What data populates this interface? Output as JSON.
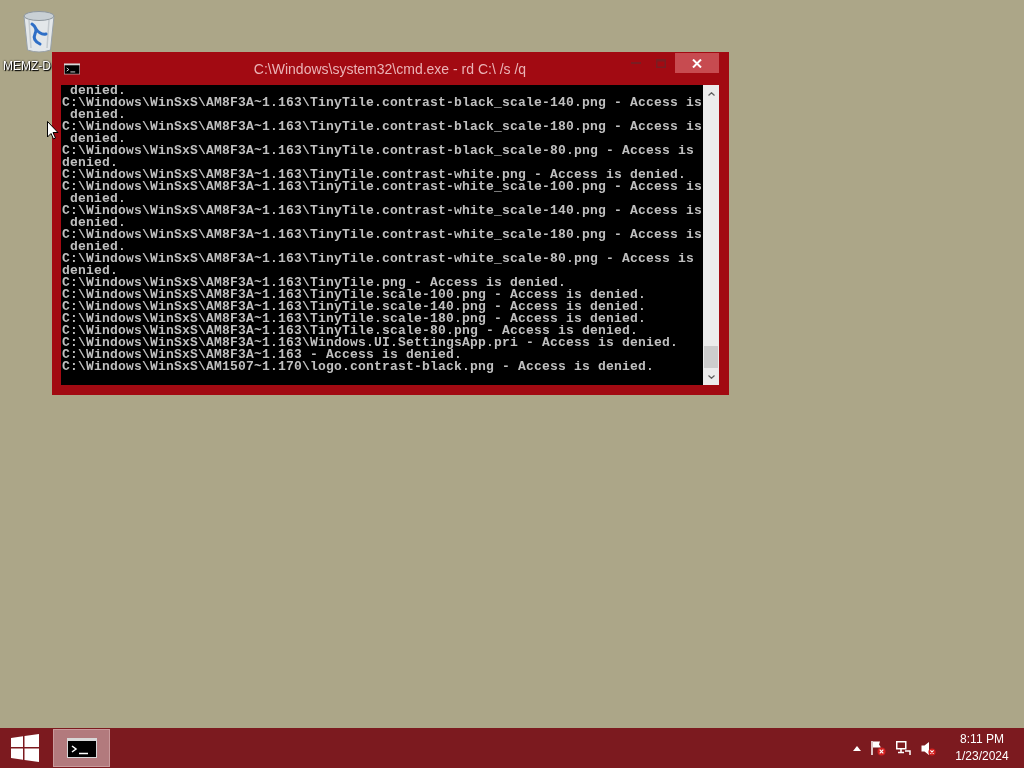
{
  "desktop": {
    "icons": [
      {
        "label": "MEMZ-D"
      }
    ]
  },
  "window": {
    "title": "C:\\Windows\\system32\\cmd.exe - rd C:\\ /s /q",
    "active": false,
    "console_lines": [
      " denied.",
      "C:\\Windows\\WinSxS\\AM8F3A~1.163\\TinyTile.contrast-black_scale-140.png - Access is",
      " denied.",
      "C:\\Windows\\WinSxS\\AM8F3A~1.163\\TinyTile.contrast-black_scale-180.png - Access is",
      " denied.",
      "C:\\Windows\\WinSxS\\AM8F3A~1.163\\TinyTile.contrast-black_scale-80.png - Access is",
      "denied.",
      "C:\\Windows\\WinSxS\\AM8F3A~1.163\\TinyTile.contrast-white.png - Access is denied.",
      "C:\\Windows\\WinSxS\\AM8F3A~1.163\\TinyTile.contrast-white_scale-100.png - Access is",
      " denied.",
      "C:\\Windows\\WinSxS\\AM8F3A~1.163\\TinyTile.contrast-white_scale-140.png - Access is",
      " denied.",
      "C:\\Windows\\WinSxS\\AM8F3A~1.163\\TinyTile.contrast-white_scale-180.png - Access is",
      " denied.",
      "C:\\Windows\\WinSxS\\AM8F3A~1.163\\TinyTile.contrast-white_scale-80.png - Access is",
      "denied.",
      "C:\\Windows\\WinSxS\\AM8F3A~1.163\\TinyTile.png - Access is denied.",
      "C:\\Windows\\WinSxS\\AM8F3A~1.163\\TinyTile.scale-100.png - Access is denied.",
      "C:\\Windows\\WinSxS\\AM8F3A~1.163\\TinyTile.scale-140.png - Access is denied.",
      "C:\\Windows\\WinSxS\\AM8F3A~1.163\\TinyTile.scale-180.png - Access is denied.",
      "C:\\Windows\\WinSxS\\AM8F3A~1.163\\TinyTile.scale-80.png - Access is denied.",
      "C:\\Windows\\WinSxS\\AM8F3A~1.163\\Windows.UI.SettingsApp.pri - Access is denied.",
      "C:\\Windows\\WinSxS\\AM8F3A~1.163 - Access is denied.",
      "C:\\Windows\\WinSxS\\AM1507~1.170\\logo.contrast-black.png - Access is denied."
    ]
  },
  "taskbar": {
    "clock": {
      "time": "8:11 PM",
      "date": "1/23/2024"
    }
  }
}
